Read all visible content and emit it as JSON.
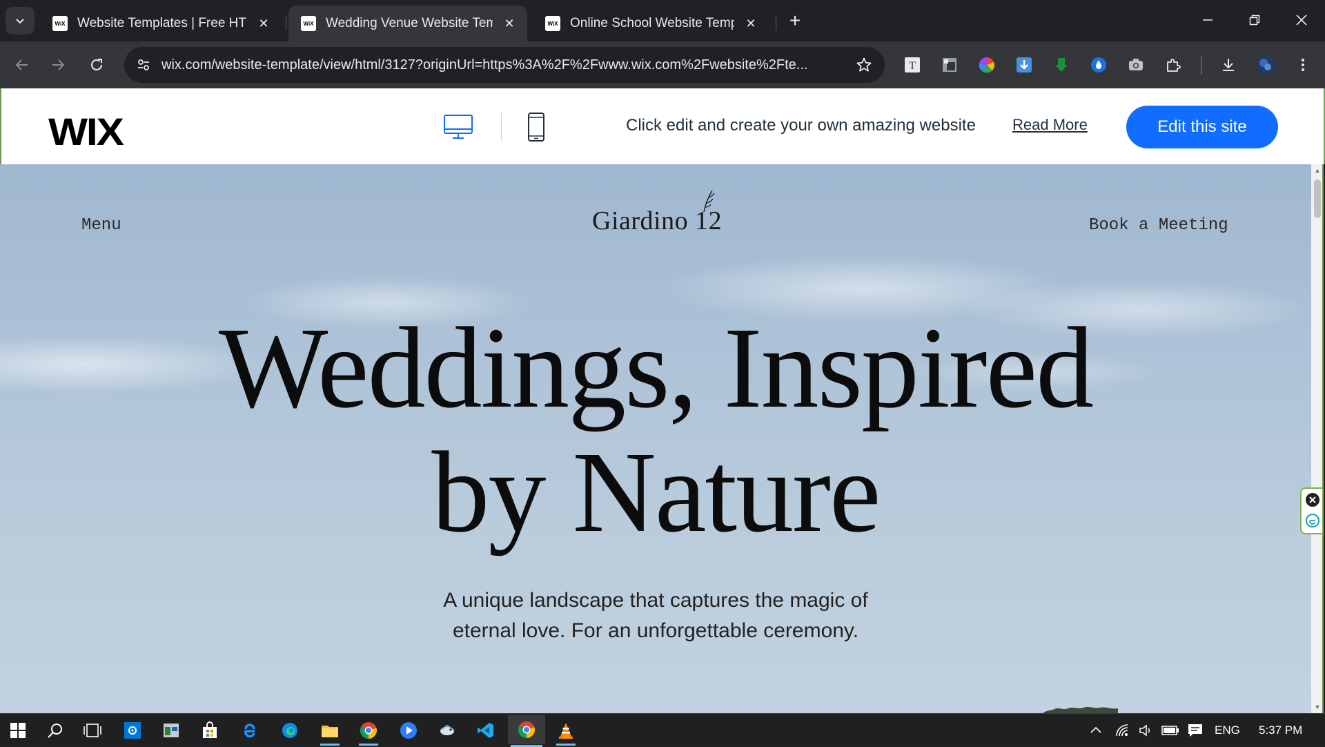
{
  "browser": {
    "tabs": [
      {
        "title": "Website Templates | Free HTML",
        "favicon": "WiX",
        "active": false
      },
      {
        "title": "Wedding Venue Website Templa",
        "favicon": "WiX",
        "active": true
      },
      {
        "title": "Online School Website Templat",
        "favicon": "WiX",
        "active": false
      }
    ],
    "url": "wix.com/website-template/view/html/3127?originUrl=https%3A%2F%2Fwww.wix.com%2Fwebsite%2Fte..."
  },
  "wix_bar": {
    "logo": "WIX",
    "tagline": "Click edit and create your own amazing website",
    "read_more": "Read More",
    "edit_button": "Edit this site",
    "accent_color": "#116dff"
  },
  "hero": {
    "menu": "Menu",
    "brand": "Giardino 12",
    "book": "Book a Meeting",
    "title_line1": "Weddings, Inspired",
    "title_line2": "by Nature",
    "subtitle_line1": "A unique landscape that captures the magic of",
    "subtitle_line2": "eternal love. For an unforgettable ceremony."
  },
  "taskbar": {
    "language": "ENG",
    "time": "5:37 PM"
  }
}
